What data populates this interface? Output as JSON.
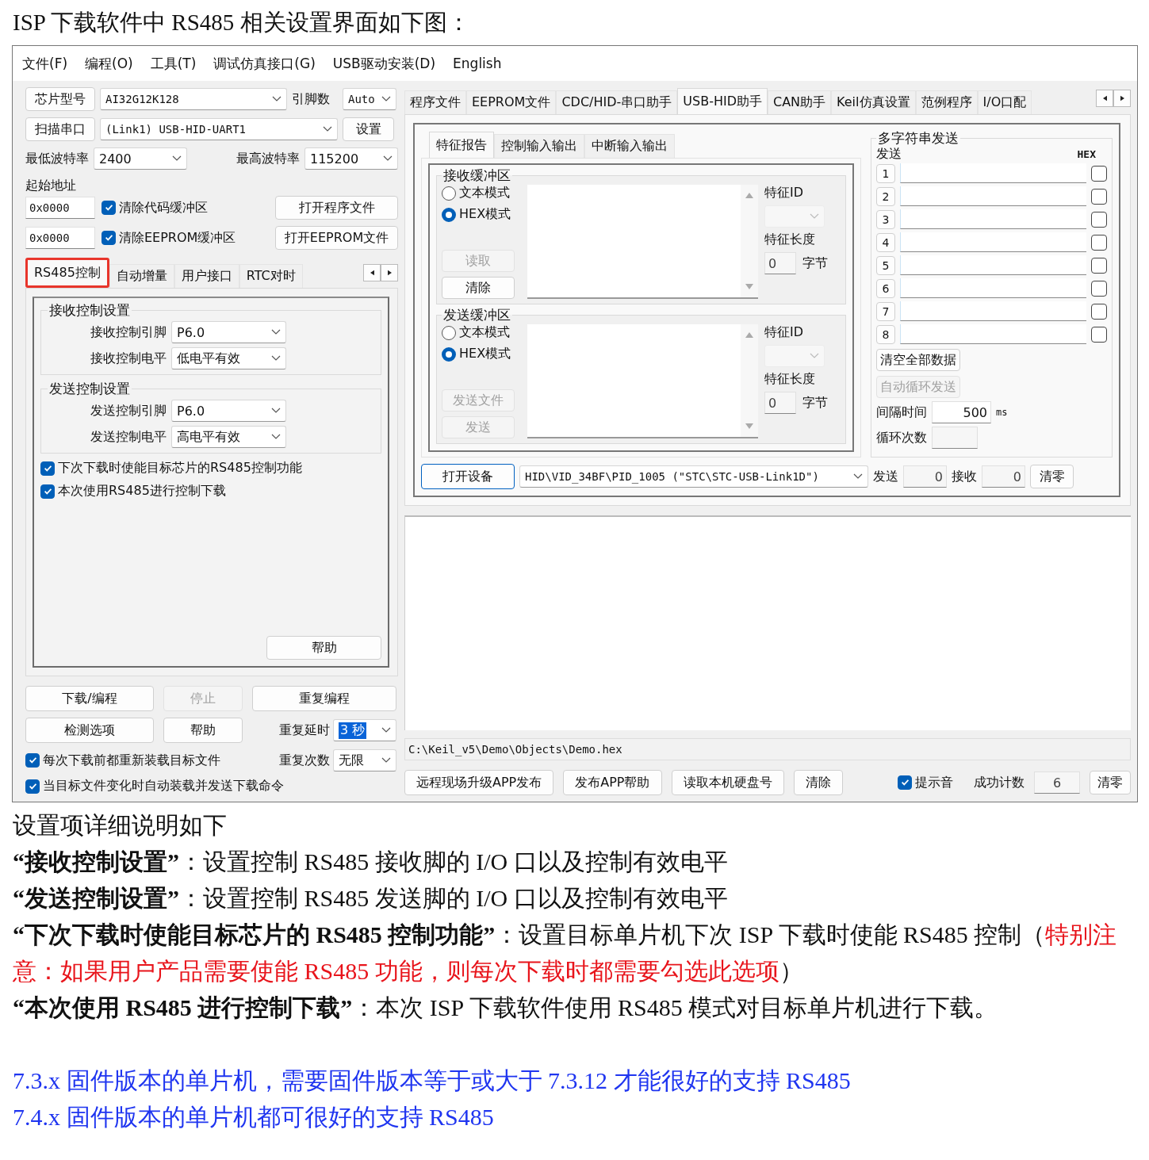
{
  "heading": "ISP 下载软件中 RS485 相关设置界面如下图：",
  "app": {
    "menu": [
      "文件(F)",
      "编程(O)",
      "工具(T)",
      "调试仿真接口(G)",
      "USB驱动安装(D)",
      "English"
    ],
    "left": {
      "chip": {
        "button": "芯片型号",
        "value": "AI32G12K128",
        "pins_label": "引脚数",
        "pins": "Auto"
      },
      "port": {
        "button": "扫描串口",
        "value": "(Link1) USB-HID-UART1",
        "settings": "设置"
      },
      "baud": {
        "min_label": "最低波特率",
        "min": "2400",
        "max_label": "最高波特率",
        "max": "115200"
      },
      "start_address_label": "起始地址",
      "address_rows": [
        {
          "address": "0x0000",
          "label": "清除代码缓冲区",
          "checked": true,
          "button": "打开程序文件"
        },
        {
          "address": "0x0000",
          "label": "清除EEPROM缓冲区",
          "checked": true,
          "button": "打开EEPROM文件"
        }
      ],
      "tabs": [
        {
          "label": "RS485控制",
          "selected": true,
          "highlighted": true
        },
        {
          "label": "自动增量",
          "selected": false,
          "highlighted": false
        },
        {
          "label": "用户接口",
          "selected": false,
          "highlighted": false
        },
        {
          "label": "RTC对时",
          "selected": false,
          "highlighted": false
        }
      ],
      "groups": [
        {
          "title": "接收控制设置",
          "fields": [
            {
              "label": "接收控制引脚",
              "value": "P6.0"
            },
            {
              "label": "接收控制电平",
              "value": "低电平有效"
            }
          ]
        },
        {
          "title": "发送控制设置",
          "fields": [
            {
              "label": "发送控制引脚",
              "value": "P6.0"
            },
            {
              "label": "发送控制电平",
              "value": "高电平有效"
            }
          ]
        }
      ],
      "options": [
        {
          "label": "下次下载时使能目标芯片的RS485控制功能",
          "checked": true
        },
        {
          "label": "本次使用RS485进行控制下载",
          "checked": true
        }
      ],
      "help": "帮助",
      "actions": [
        {
          "label": "下载/编程",
          "disabled": false
        },
        {
          "label": "停止",
          "disabled": true
        },
        {
          "label": "重复编程",
          "disabled": false
        },
        {
          "label": "检测选项",
          "disabled": false
        },
        {
          "label": "帮助",
          "disabled": false
        }
      ],
      "repeat_delay": {
        "label": "重复延时",
        "value": "3 秒",
        "value_selected": true
      },
      "repeat_count": {
        "label": "重复次数",
        "value": "无限"
      },
      "bottom_options": [
        {
          "label": "每次下载前都重新装载目标文件",
          "checked": true
        },
        {
          "label": "当目标文件变化时自动装载并发送下载命令",
          "checked": true
        }
      ]
    },
    "right": {
      "tabs": [
        {
          "label": "程序文件",
          "selected": false
        },
        {
          "label": "EEPROM文件",
          "selected": false
        },
        {
          "label": "CDC/HID-串口助手",
          "selected": false
        },
        {
          "label": "USB-HID助手",
          "selected": true
        },
        {
          "label": "CAN助手",
          "selected": false
        },
        {
          "label": "Keil仿真设置",
          "selected": false
        },
        {
          "label": "范例程序",
          "selected": false
        },
        {
          "label": "I/O口配",
          "selected": false
        }
      ],
      "subtabs": [
        {
          "label": "特征报告",
          "selected": true
        },
        {
          "label": "控制输入输出",
          "selected": false
        },
        {
          "label": "中断输入输出",
          "selected": false
        }
      ],
      "buffers": [
        {
          "title": "接收缓冲区",
          "modes": [
            {
              "label": "文本模式",
              "selected": false
            },
            {
              "label": "HEX模式",
              "selected": true
            }
          ],
          "buttons": [
            {
              "label": "读取",
              "disabled": true
            },
            {
              "label": "清除",
              "disabled": false
            }
          ],
          "id_label": "特征ID",
          "length_label": "特征长度",
          "length": "0",
          "unit": "字节"
        },
        {
          "title": "发送缓冲区",
          "modes": [
            {
              "label": "文本模式",
              "selected": false
            },
            {
              "label": "HEX模式",
              "selected": true
            }
          ],
          "buttons": [
            {
              "label": "发送文件",
              "disabled": true
            },
            {
              "label": "发送",
              "disabled": true
            }
          ],
          "id_label": "特征ID",
          "length_label": "特征长度",
          "length": "0",
          "unit": "字节"
        }
      ],
      "multi": {
        "title": "多字符串发送",
        "send_label": "发送",
        "hex_label": "HEX",
        "rows": [
          {
            "number": "1",
            "hex": false
          },
          {
            "number": "2",
            "hex": false
          },
          {
            "number": "3",
            "hex": false
          },
          {
            "number": "4",
            "hex": false
          },
          {
            "number": "5",
            "hex": false
          },
          {
            "number": "6",
            "hex": false
          },
          {
            "number": "7",
            "hex": false
          },
          {
            "number": "8",
            "hex": false
          }
        ],
        "clear_all": "清空全部数据",
        "auto": {
          "label": "自动循环发送",
          "disabled": true
        },
        "interval_label": "间隔时间",
        "interval": "500",
        "interval_unit": "ms",
        "loop_label": "循环次数"
      },
      "device": {
        "button": "打开设备",
        "value": "HID\\VID_34BF\\PID_1005 (\"STC\\STC-USB-Link1D\")",
        "send_label": "发送",
        "send": "0",
        "recv_label": "接收",
        "recv": "0",
        "clear": "清零"
      },
      "path": "C:\\Keil_v5\\Demo\\Objects\\Demo.hex",
      "bottom_buttons": [
        "远程现场升级APP发布",
        "发布APP帮助",
        "读取本机硬盘号",
        "清除"
      ],
      "beep": {
        "label": "提示音",
        "checked": true
      },
      "count_label": "成功计数",
      "count": "6",
      "count_clear": "清零"
    }
  },
  "notes": [
    {
      "text": "设置项详细说明如下"
    },
    {
      "text": "**“接收控制设置”**：设置控制 RS485 接收脚的 I/O 口以及控制有效电平"
    },
    {
      "text": "**“发送控制设置”**：设置控制 RS485 发送脚的 I/O 口以及控制有效电平"
    },
    {
      "text": "**“下次下载时使能目标芯片的 RS485 控制功能”**：设置目标单片机下次 ISP 下载时使能 RS485 控制（",
      "warning": "特别注意：如果用户产品需要使能 RS485 功能，则每次下载时都需要勾选此选项",
      "after": "）"
    },
    {
      "text": "**“本次使用 RS485 进行控制下载”**：本次 ISP 下载软件使用 RS485 模式对目标单片机进行下载。"
    }
  ],
  "version_notes": [
    "7.3.x 固件版本的单片机，需要固件版本等于或大于 7.3.12 才能很好的支持 RS485",
    "7.4.x 固件版本的单片机都可很好的支持 RS485"
  ]
}
